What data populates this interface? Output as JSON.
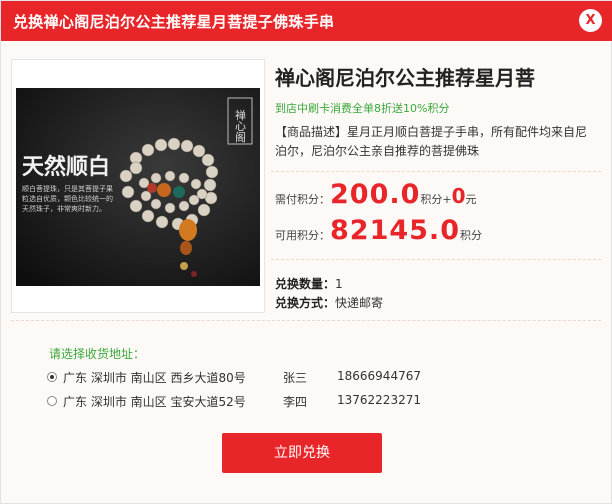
{
  "dialog": {
    "title": "兑换禅心阁尼泊尔公主推荐星月菩提子佛珠手串",
    "close_label": "X"
  },
  "product": {
    "image_overlay": {
      "seal": "禅心阁",
      "headline": "天然顺白",
      "caption": "顺白菩提珠，只是其菩提子果粒选自优质，颗色比较统一的天然珠子，非常爽时新力。"
    },
    "name": "禅心阁尼泊尔公主推荐星月菩",
    "promo": "到店中刷卡消费全单8折送10%积分",
    "description": "【商品描述】星月正月顺白菩提子手串，所有配件均来自尼泊尔，尼泊尔公主亲自推荐的菩提佛珠",
    "price": {
      "need_label": "需付积分：",
      "need_value": "200.0",
      "need_unit": "积分",
      "plus": "+",
      "cash_value": "0",
      "cash_unit": "元",
      "available_label": "可用积分：",
      "available_value": "82145.0",
      "available_unit": "积分"
    },
    "quantity_label": "兑换数量：",
    "quantity_value": "1",
    "method_label": "兑换方式：",
    "method_value": "快递邮寄"
  },
  "address": {
    "title": "请选择收货地址：",
    "options": [
      {
        "text": "广东 深圳市 南山区 西乡大道80号",
        "name": "张三",
        "phone": "18666944767",
        "selected": true
      },
      {
        "text": "广东 深圳市 南山区 宝安大道52号",
        "name": "李四",
        "phone": "13762223271",
        "selected": false
      }
    ]
  },
  "submit_label": "立即兑换",
  "colors": {
    "accent": "#e8262a",
    "green": "#3aa83a"
  }
}
